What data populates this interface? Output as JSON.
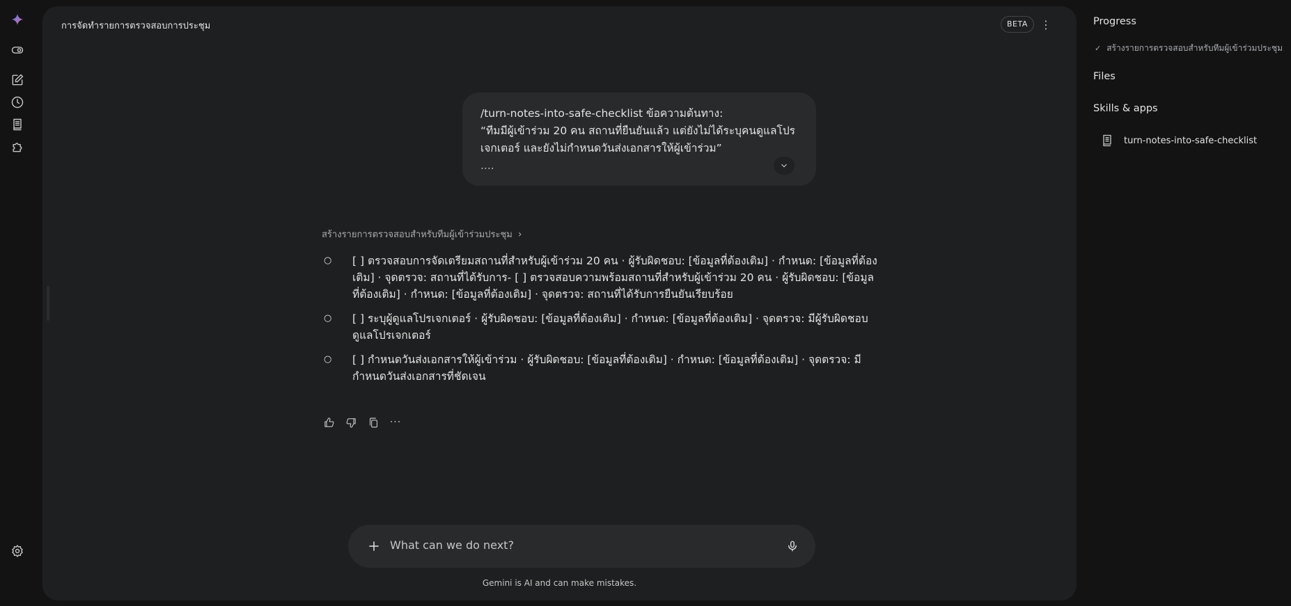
{
  "header": {
    "title": "การจัดทำรายการตรวจสอบการประชุม",
    "badge": "BETA",
    "menu_icon": "more-vertical-icon"
  },
  "rail": {
    "icons": [
      "gemini-logo-icon",
      "toggle-icon",
      "new-chat-icon",
      "history-icon",
      "notebook-icon",
      "extensions-icon",
      "settings-icon"
    ]
  },
  "user_message": {
    "line1": "/turn-notes-into-safe-checklist ข้อความต้นทาง:",
    "line2": "“ทีมมีผู้เข้าร่วม 20 คน สถานที่ยืนยันแล้ว แต่ยังไม่ได้ระบุคนดูแลโปร",
    "line3": "เจกเตอร์ และยังไม่กำหนดวันส่งเอกสารให้ผู้เข้าร่วม”",
    "line4": "...."
  },
  "response": {
    "thought_label": "สร้างรายการตรวจสอบสำหรับทีมผู้เข้าร่วมประชุม",
    "bullet": "○",
    "items": [
      "[ ] ตรวจสอบการจัดเตรียมสถานที่สำหรับผู้เข้าร่วม 20 คน · ผู้รับผิดชอบ: [ข้อมูลที่ต้องเติม] · กำหนด: [ข้อมูลที่ต้องเติม] · จุดตรวจ: สถานที่ได้รับการ- [ ] ตรวจสอบความพร้อมสถานที่สำหรับผู้เข้าร่วม 20 คน · ผู้รับผิดชอบ: [ข้อมูลที่ต้องเติม] · กำหนด: [ข้อมูลที่ต้องเติม] · จุดตรวจ: สถานที่ได้รับการยืนยันเรียบร้อย",
      "[ ] ระบุผู้ดูแลโปรเจกเตอร์ · ผู้รับผิดชอบ: [ข้อมูลที่ต้องเติม] · กำหนด: [ข้อมูลที่ต้องเติม] · จุดตรวจ: มีผู้รับผิดชอบดูแลโปรเจกเตอร์",
      "[ ] กำหนดวันส่งเอกสารให้ผู้เข้าร่วม · ผู้รับผิดชอบ: [ข้อมูลที่ต้องเติม] · กำหนด: [ข้อมูลที่ต้องเติม] · จุดตรวจ: มีกำหนดวันส่งเอกสารที่ชัดเจน"
    ],
    "more_label": "···"
  },
  "composer": {
    "placeholder": "What can we do next?"
  },
  "disclaimer": "Gemini is AI and can make mistakes.",
  "sidebar": {
    "progress_title": "Progress",
    "progress_item": "สร้างรายการตรวจสอบสำหรับทีมผู้เข้าร่วมประชุม",
    "check": "✓",
    "files_title": "Files",
    "skills_title": "Skills & apps",
    "skill_name": "turn-notes-into-safe-checklist"
  }
}
